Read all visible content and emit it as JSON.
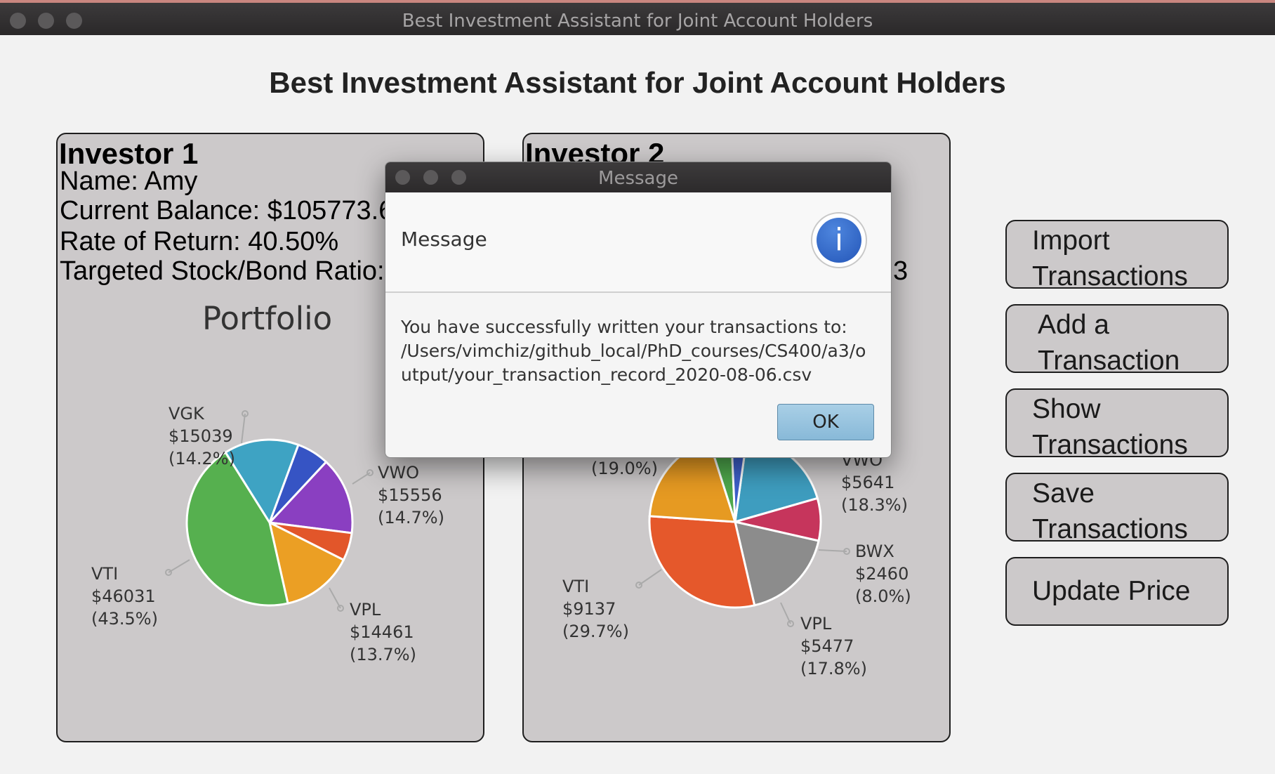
{
  "window": {
    "title": "Best Investment Assistant for Joint Account Holders"
  },
  "app_title": "Best Investment Assistant for Joint Account Holders",
  "investor1": {
    "heading": "Investor 1",
    "name": "Name: Amy",
    "balance": "Current Balance: $105773.6",
    "return": "Rate of Return: 40.50%",
    "ratio": "Targeted Stock/Bond Ratio:",
    "chart_title": "Portfolio"
  },
  "investor2": {
    "heading": "Investor 2",
    "ratio_tail": "3"
  },
  "buttons": {
    "import": [
      "Import",
      "Transactions"
    ],
    "add": [
      "Add a",
      "Transaction"
    ],
    "show": [
      "Show",
      "Transactions"
    ],
    "save": [
      "Save",
      "Transactions"
    ],
    "update": "Update Price"
  },
  "dialog": {
    "title": "Message",
    "header": "Message",
    "icon": "info-icon",
    "body_lines": [
      "You have successfully written your transactions to:",
      "/Users/vimchiz/github_local/PhD_courses/CS400/a3/o",
      "utput/your_transaction_record_2020-08-06.csv"
    ],
    "ok_label": "OK"
  },
  "chart_data": [
    {
      "type": "pie",
      "title": "Portfolio",
      "slices": [
        {
          "name": "VWO",
          "value": 15556,
          "percent": "14.7%",
          "color": "#8a3fc1"
        },
        {
          "name": "",
          "value": 5600,
          "percent": "",
          "color": "#e2562a"
        },
        {
          "name": "VPL",
          "value": 14461,
          "percent": "13.7%",
          "color": "#eb9f24"
        },
        {
          "name": "VTI",
          "value": 46031,
          "percent": "43.5%",
          "color": "#56b04f"
        },
        {
          "name": "VGK",
          "value": 15039,
          "percent": "14.2%",
          "color": "#3ea3c3"
        },
        {
          "name": "",
          "value": 6500,
          "percent": "",
          "color": "#3654c4"
        }
      ],
      "labels": [
        [
          "VGK",
          "$15039",
          "(14.2%)"
        ],
        [
          "VWO",
          "$15556",
          "(14.7%)"
        ],
        [
          "VTI",
          "$46031",
          "(43.5%)"
        ],
        [
          "VPL",
          "$14461",
          "(13.7%)"
        ]
      ]
    },
    {
      "type": "pie",
      "title": "",
      "slices": [
        {
          "name": "VWO",
          "value": 5641,
          "percent": "18.3%",
          "color": "#3e9dbf"
        },
        {
          "name": "BWX",
          "value": 2460,
          "percent": "8.0%",
          "color": "#c6355c"
        },
        {
          "name": "VPL",
          "value": 5477,
          "percent": "17.8%",
          "color": "#8c8c8c"
        },
        {
          "name": "VTI",
          "value": 9137,
          "percent": "29.7%",
          "color": "#e5582b"
        },
        {
          "name": "",
          "value": 5850,
          "percent": "19.0%",
          "color": "#e69a22"
        },
        {
          "name": "",
          "value": 1300,
          "percent": "",
          "color": "#4ea84c"
        },
        {
          "name": "",
          "value": 900,
          "percent": "",
          "color": "#3d5fc9"
        }
      ],
      "labels": [
        [
          "VWO",
          "$5641",
          "(18.3%)"
        ],
        [
          "BWX",
          "$2460",
          "(8.0%)"
        ],
        [
          "VPL",
          "$5477",
          "(17.8%)"
        ],
        [
          "VTI",
          "$9137",
          "(29.7%)"
        ],
        [
          "(19.0%)"
        ]
      ]
    }
  ]
}
